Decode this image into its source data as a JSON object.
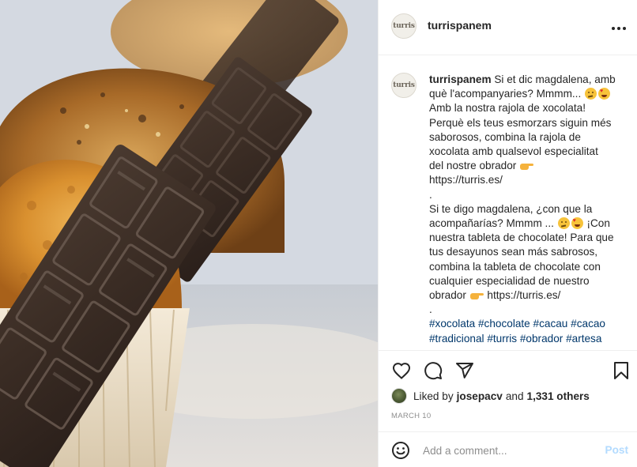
{
  "post": {
    "image_alt": "Magdalenes amb rajola de xocolata",
    "header": {
      "avatar_text": "turris",
      "username": "turrispanem",
      "more_icon": "more-horizontal-icon"
    },
    "caption": {
      "avatar_text": "turris",
      "username": "turrispanem",
      "lines": [
        {
          "text": "Si et dic magdalena, amb",
          "emoji": []
        },
        {
          "text": "què l'acompanyaries? Mmmm...",
          "emoji": [
            "thinking-face",
            "heart-eyes"
          ]
        },
        {
          "text": "Amb la nostra rajola de xocolata!",
          "emoji": []
        },
        {
          "text": "Perquè els teus esmorzars siguin més",
          "emoji": []
        },
        {
          "text": "saborosos, combina la rajola de",
          "emoji": []
        },
        {
          "text": "xocolata amb qualsevol especialitat",
          "emoji": []
        },
        {
          "text": "del nostre obrador",
          "emoji": [
            "pointing-right"
          ]
        },
        {
          "text": "https://turris.es/",
          "emoji": []
        },
        {
          "text": ".",
          "emoji": []
        },
        {
          "text": "Si te digo magdalena, ¿con que la",
          "emoji": []
        },
        {
          "text": "acompañarías? Mmmm ...",
          "emoji": [
            "thinking-face",
            "heart-eyes"
          ],
          "after": " ¡Con"
        },
        {
          "text": "nuestra tableta de chocolate! Para que",
          "emoji": []
        },
        {
          "text": "tus desayunos sean más sabrosos,",
          "emoji": []
        },
        {
          "text": "combina la tableta de chocolate con",
          "emoji": []
        },
        {
          "text": "cualquier especialidad de nuestro",
          "emoji": []
        },
        {
          "text": "obrador",
          "emoji": [
            "pointing-right"
          ],
          "after": " https://turris.es/"
        },
        {
          "text": ".",
          "emoji": []
        }
      ],
      "hashtags_line1": [
        "#xocolata",
        "#chocolate",
        "#cacau",
        "#cacao"
      ],
      "hashtags_line2": [
        "#tradicional",
        "#turris",
        "#obrador",
        "#artesa"
      ]
    },
    "actions": {
      "like_icon": "heart-outline-icon",
      "comment_icon": "comment-bubble-icon",
      "share_icon": "paper-plane-icon",
      "save_icon": "bookmark-icon"
    },
    "likes": {
      "prefix": "Liked by",
      "user": "josepacv",
      "middle": "and",
      "count": "1,331 others"
    },
    "date": "MARCH 10",
    "add_comment": {
      "placeholder": "Add a comment...",
      "post_label": "Post",
      "emoji_icon": "smiley-icon"
    }
  },
  "colors": {
    "text": "#262626",
    "muted": "#8e8e8e",
    "hashtag": "#00376b",
    "post_disabled": "#b3dbff",
    "border": "#efefef"
  }
}
